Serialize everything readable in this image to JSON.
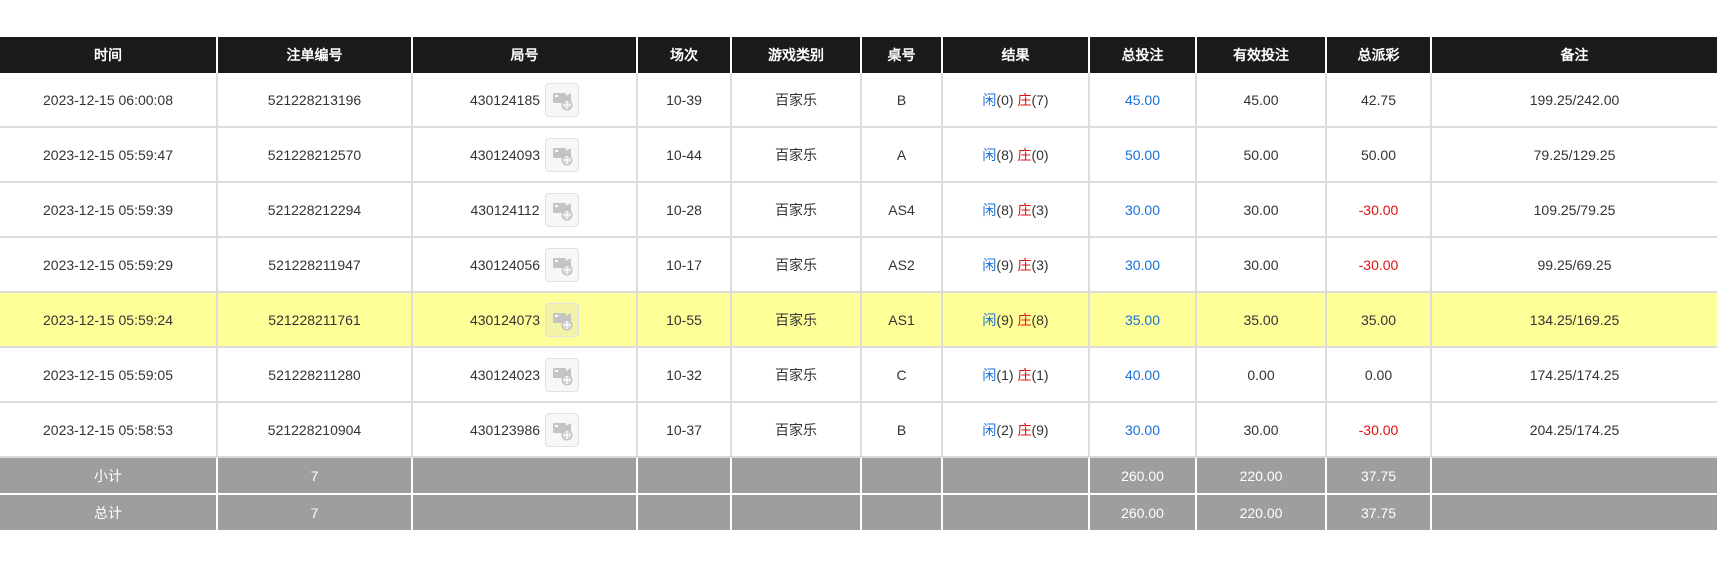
{
  "headers": [
    "时间",
    "注单编号",
    "局号",
    "场次",
    "游戏类别",
    "桌号",
    "结果",
    "总投注",
    "有效投注",
    "总派彩",
    "备注"
  ],
  "colors": {
    "header_bg": "#1b1b1b",
    "highlight_row": "#ffff99",
    "footer_bg": "#9e9e9e",
    "player_text": "#1a6fd8",
    "banker_text": "#e01010",
    "bet_text": "#1a6fd8",
    "negative_payout": "#e01010"
  },
  "result_labels": {
    "player": "闲",
    "banker": "庄"
  },
  "rows": [
    {
      "time": "2023-12-15 06:00:08",
      "bet_id": "521228213196",
      "round": "430124185",
      "session": "10-39",
      "game": "百家乐",
      "table": "B",
      "player_score": "(0)",
      "banker_score": "(7)",
      "total_bet": "45.00",
      "valid_bet": "45.00",
      "payout": "42.75",
      "payout_negative": false,
      "note": "199.25/242.00",
      "highlighted": false
    },
    {
      "time": "2023-12-15 05:59:47",
      "bet_id": "521228212570",
      "round": "430124093",
      "session": "10-44",
      "game": "百家乐",
      "table": "A",
      "player_score": "(8)",
      "banker_score": "(0)",
      "total_bet": "50.00",
      "valid_bet": "50.00",
      "payout": "50.00",
      "payout_negative": false,
      "note": "79.25/129.25",
      "highlighted": false
    },
    {
      "time": "2023-12-15 05:59:39",
      "bet_id": "521228212294",
      "round": "430124112",
      "session": "10-28",
      "game": "百家乐",
      "table": "AS4",
      "player_score": "(8)",
      "banker_score": "(3)",
      "total_bet": "30.00",
      "valid_bet": "30.00",
      "payout": "-30.00",
      "payout_negative": true,
      "note": "109.25/79.25",
      "highlighted": false
    },
    {
      "time": "2023-12-15 05:59:29",
      "bet_id": "521228211947",
      "round": "430124056",
      "session": "10-17",
      "game": "百家乐",
      "table": "AS2",
      "player_score": "(9)",
      "banker_score": "(3)",
      "total_bet": "30.00",
      "valid_bet": "30.00",
      "payout": "-30.00",
      "payout_negative": true,
      "note": "99.25/69.25",
      "highlighted": false
    },
    {
      "time": "2023-12-15 05:59:24",
      "bet_id": "521228211761",
      "round": "430124073",
      "session": "10-55",
      "game": "百家乐",
      "table": "AS1",
      "player_score": "(9)",
      "banker_score": "(8)",
      "total_bet": "35.00",
      "valid_bet": "35.00",
      "payout": "35.00",
      "payout_negative": false,
      "note": "134.25/169.25",
      "highlighted": true
    },
    {
      "time": "2023-12-15 05:59:05",
      "bet_id": "521228211280",
      "round": "430124023",
      "session": "10-32",
      "game": "百家乐",
      "table": "C",
      "player_score": "(1)",
      "banker_score": "(1)",
      "total_bet": "40.00",
      "valid_bet": "0.00",
      "payout": "0.00",
      "payout_negative": false,
      "note": "174.25/174.25",
      "highlighted": false
    },
    {
      "time": "2023-12-15 05:58:53",
      "bet_id": "521228210904",
      "round": "430123986",
      "session": "10-37",
      "game": "百家乐",
      "table": "B",
      "player_score": "(2)",
      "banker_score": "(9)",
      "total_bet": "30.00",
      "valid_bet": "30.00",
      "payout": "-30.00",
      "payout_negative": true,
      "note": "204.25/174.25",
      "highlighted": false
    }
  ],
  "subtotal": {
    "label": "小计",
    "count": "7",
    "total_bet": "260.00",
    "valid_bet": "220.00",
    "payout": "37.75"
  },
  "grand_total": {
    "label": "总计",
    "count": "7",
    "total_bet": "260.00",
    "valid_bet": "220.00",
    "payout": "37.75"
  },
  "icons": {
    "replay": "video-replay-icon"
  }
}
